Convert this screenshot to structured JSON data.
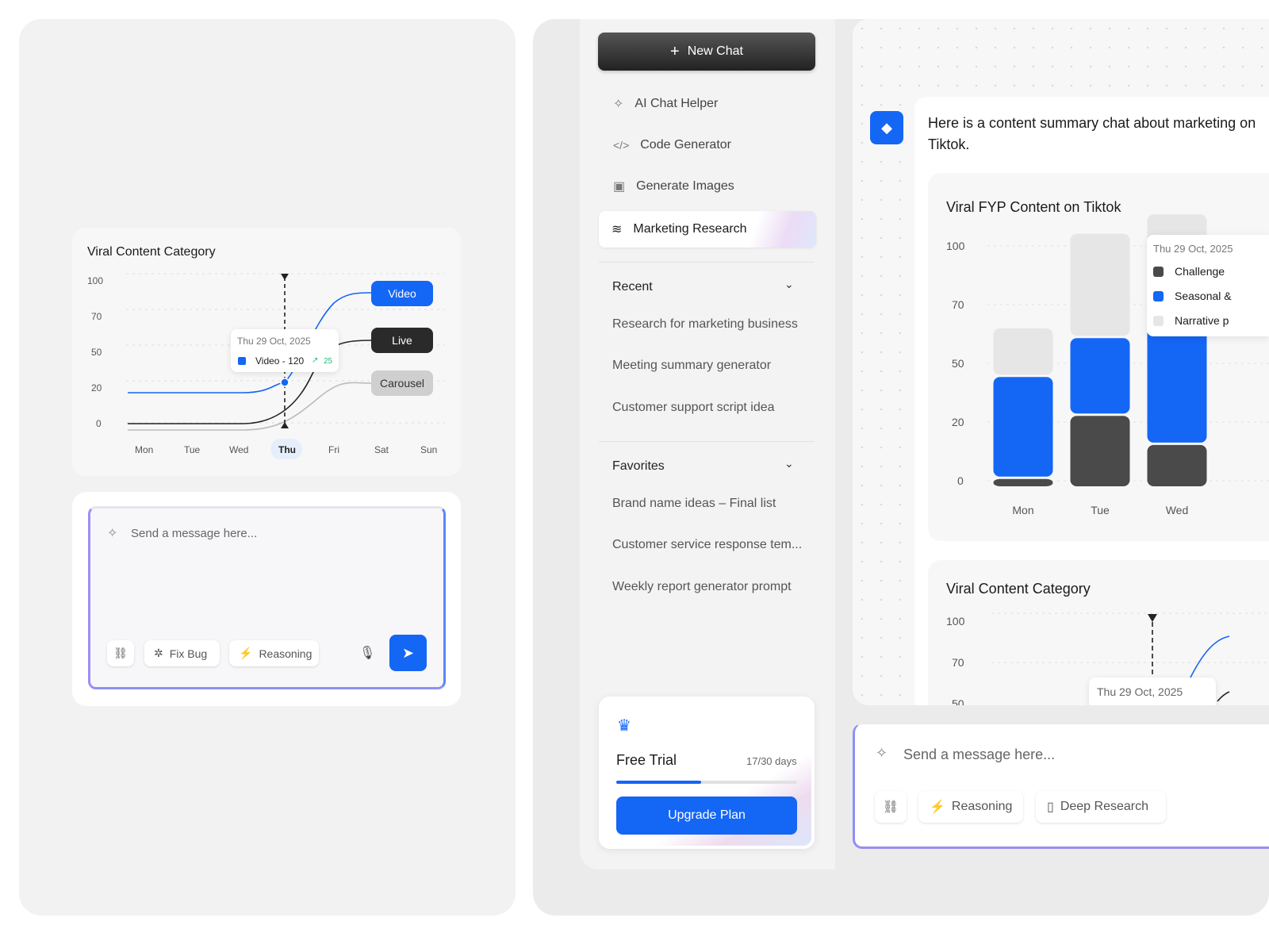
{
  "left_chart": {
    "title": "Viral Content Category",
    "y_ticks": [
      "100",
      "70",
      "50",
      "20",
      "0"
    ],
    "days": [
      "Mon",
      "Tue",
      "Wed",
      "Thu",
      "Fri",
      "Sat",
      "Sun"
    ],
    "selected_day": "Thu",
    "tooltip": {
      "date": "Thu 29 Oct, 2025",
      "series": "Video - 120",
      "delta": "25"
    },
    "tags": {
      "video": "Video",
      "live": "Live",
      "carousel": "Carousel"
    }
  },
  "left_composer": {
    "placeholder": "Send a message here...",
    "fix_bug": "Fix Bug",
    "reasoning": "Reasoning"
  },
  "sidebar": {
    "new_chat": "New Chat",
    "nav": [
      {
        "label": "AI Chat Helper",
        "icon": "sparkle-icon"
      },
      {
        "label": "Code Generator",
        "icon": "code-icon"
      },
      {
        "label": "Generate Images",
        "icon": "image-icon"
      },
      {
        "label": "Marketing Research",
        "icon": "layers-icon"
      }
    ],
    "recent_title": "Recent",
    "recent": [
      "Research for marketing business",
      "Meeting summary generator",
      "Customer support script idea"
    ],
    "favorites_title": "Favorites",
    "favorites": [
      "Brand name ideas – Final list",
      "Customer service response tem...",
      "Weekly report generator prompt"
    ],
    "trial": {
      "title": "Free Trial",
      "days": "17/30 days",
      "progress": 0.47,
      "upgrade": "Upgrade Plan"
    }
  },
  "chat": {
    "message": "Here is a content summary chat about marketing on Tiktok.",
    "fyp_chart": {
      "title": "Viral FYP Content on Tiktok",
      "y_ticks": [
        "100",
        "70",
        "50",
        "20",
        "0"
      ],
      "tooltip_date": "Thu 29 Oct, 2025",
      "legend": [
        "Challenge",
        "Seasonal &",
        "Narrative p"
      ]
    },
    "viral_chart": {
      "title": "Viral Content Category",
      "y_ticks": [
        "100",
        "70",
        "50"
      ],
      "tooltip_date": "Thu 29 Oct, 2025"
    },
    "composer": {
      "placeholder": "Send a message here...",
      "reasoning": "Reasoning",
      "deep_research": "Deep Research"
    }
  },
  "colors": {
    "accent": "#1466f5",
    "dark": "#4a4a4a",
    "light": "#e6e6e6"
  },
  "chart_data": {
    "type": "bar",
    "title": "Viral FYP Content on Tiktok",
    "categories": [
      "Mon",
      "Tue",
      "Wed"
    ],
    "series": [
      {
        "name": "Challenge",
        "values": [
          4,
          30,
          18
        ]
      },
      {
        "name": "Seasonal &",
        "values": [
          42,
          32,
          75
        ]
      },
      {
        "name": "Narrative p",
        "values": [
          20,
          43,
          20
        ]
      }
    ],
    "ylim": [
      0,
      100
    ]
  }
}
